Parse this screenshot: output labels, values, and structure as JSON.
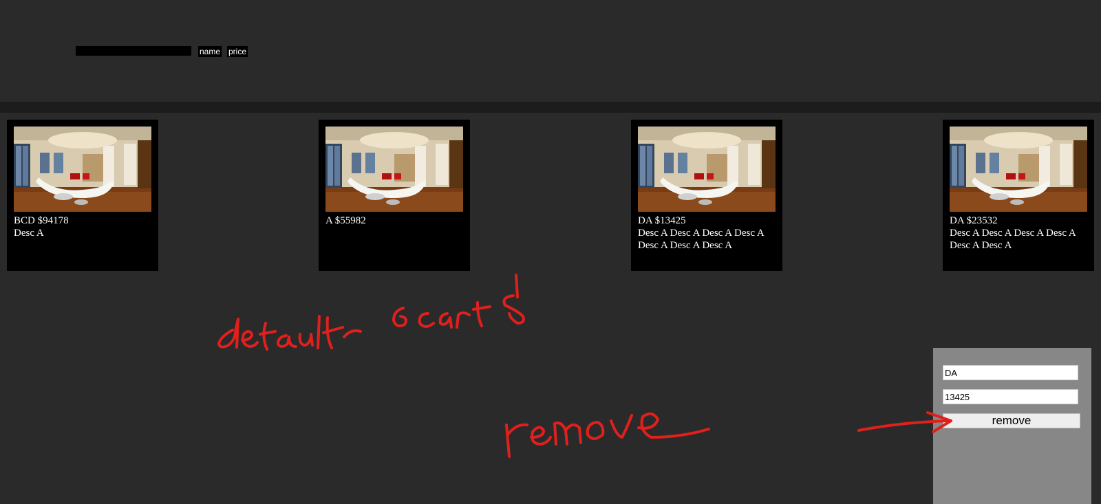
{
  "toolbar": {
    "search_value": "",
    "sort_name_label": "name",
    "sort_price_label": "price"
  },
  "cards": [
    {
      "title": "BCD $94178",
      "desc": "Desc A"
    },
    {
      "title": "A $55982",
      "desc": ""
    },
    {
      "title": "DA $13425",
      "desc": "Desc A Desc A Desc A Desc A Desc A Desc A Desc A"
    },
    {
      "title": "DA $23532",
      "desc": "Desc A Desc A Desc A Desc A Desc A Desc A"
    }
  ],
  "panel": {
    "name_value": "DA",
    "price_value": "13425",
    "remove_label": "remove"
  },
  "annotations": {
    "note_1": "default 6carts",
    "note_2": "remove",
    "color": "#e0201c"
  },
  "colors": {
    "background": "#2a2a2a",
    "card": "#000000",
    "panel": "#878787"
  }
}
